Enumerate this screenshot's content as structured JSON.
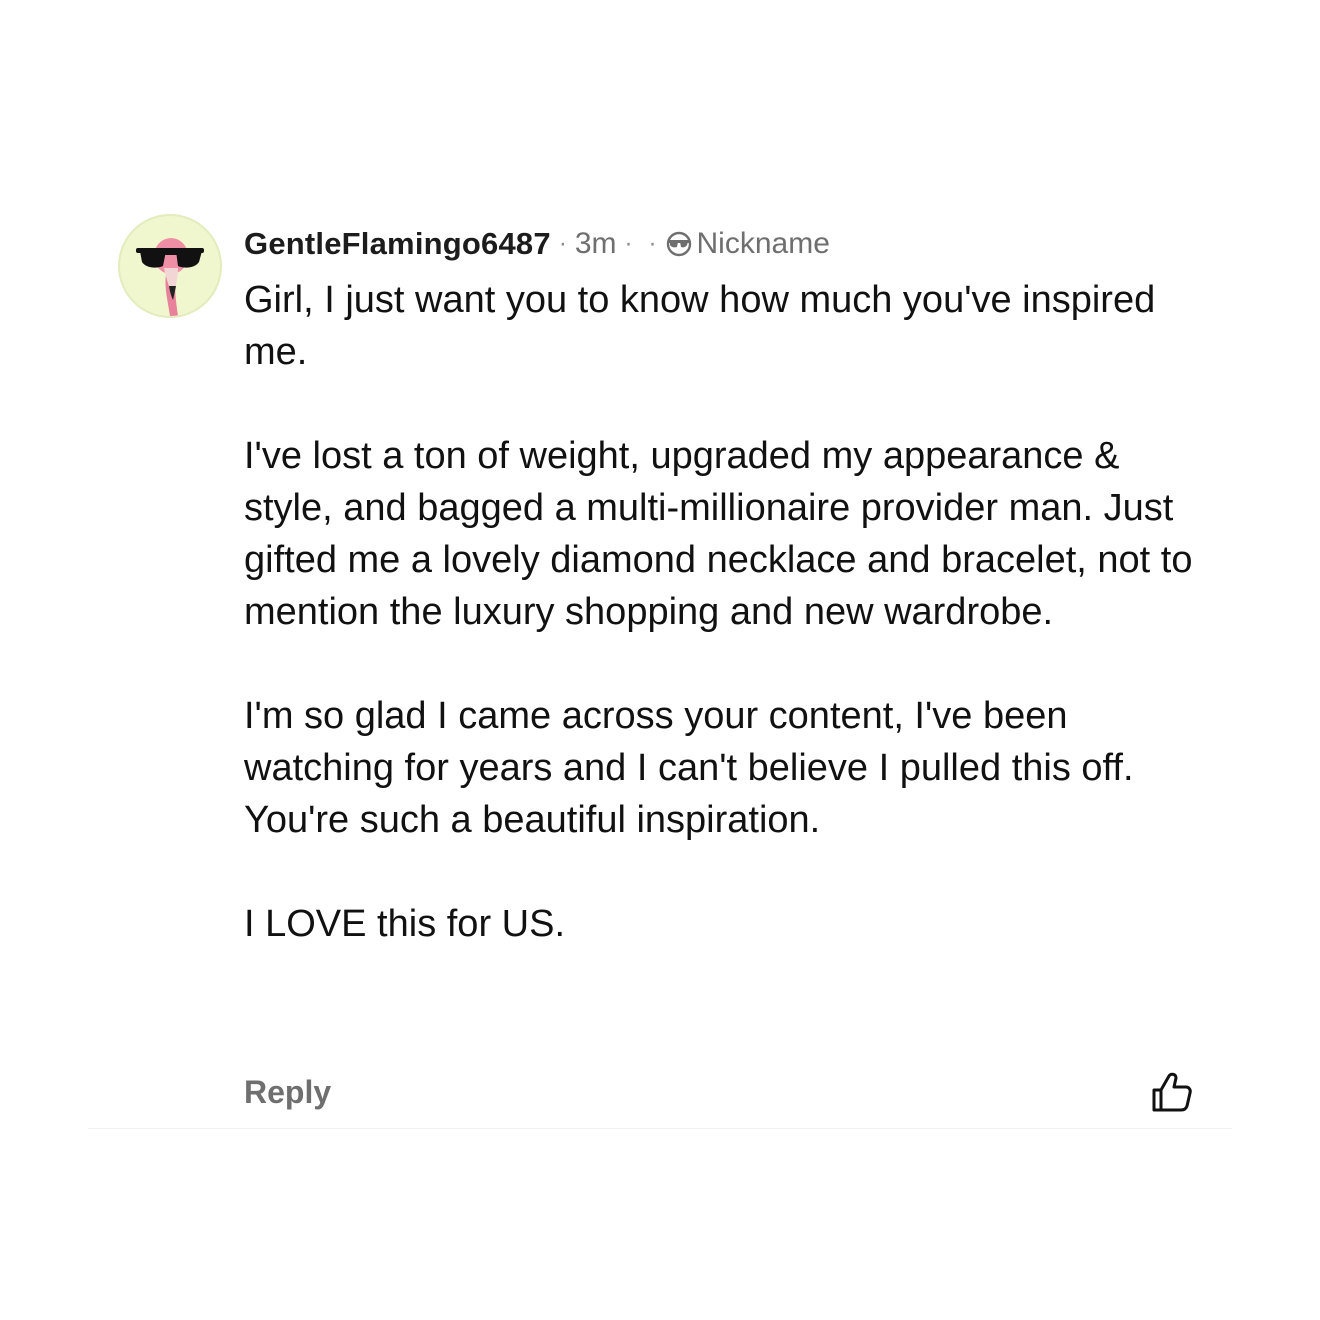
{
  "comment": {
    "username": "GentleFlamingo6487",
    "separator": "·",
    "time": "3m",
    "nickname": "Nickname",
    "paragraphs": [
      "Girl, I just want you to know how much you've inspired me.",
      "I've lost a ton of weight, upgraded my appearance & style, and bagged a multi-millionaire provider man. Just gifted me a lovely diamond necklace and bracelet, not to mention the luxury shopping and new wardrobe.",
      "I'm so glad I came across your content, I've been watching for years and I can't believe I pulled this off. You're such a beautiful inspiration.",
      "I LOVE this for US."
    ],
    "reply_label": "Reply",
    "icons": {
      "avatar": "flamingo-sunglasses-avatar",
      "nickname": "sunglasses-mask-icon",
      "like": "thumbs-up-icon"
    },
    "colors": {
      "avatar_bg": "#f0f7cf",
      "flamingo": "#e8829a",
      "muted": "#6f6f6f"
    }
  }
}
